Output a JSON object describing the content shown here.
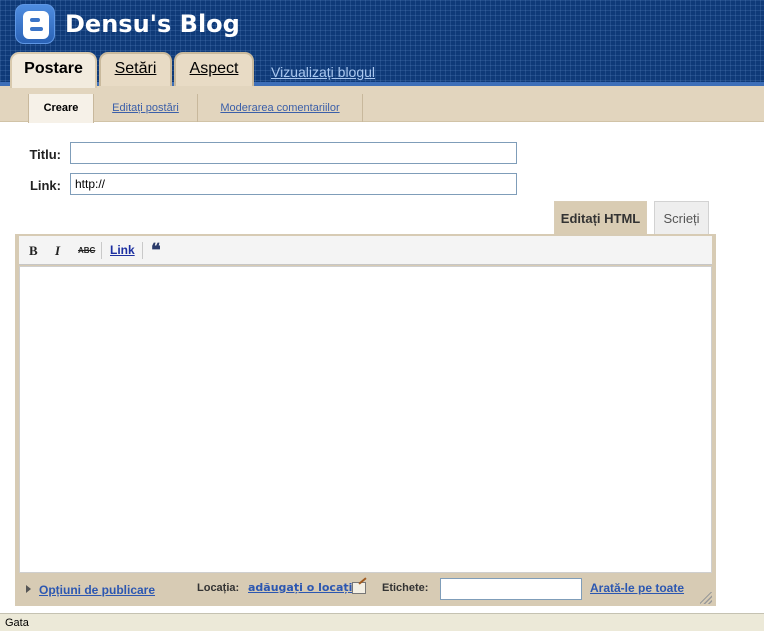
{
  "header": {
    "blog_title": "Densu's Blog",
    "logo_icon": "blogger-logo-icon",
    "tabs": [
      {
        "label": "Postare",
        "active": true
      },
      {
        "label": "Setări",
        "active": false
      },
      {
        "label": "Aspect",
        "active": false
      }
    ],
    "view_blog_link": "Vizualizați blogul"
  },
  "subnav": {
    "items": [
      {
        "label": "Creare",
        "active": true
      },
      {
        "label": "Editați postări",
        "active": false
      },
      {
        "label": "Moderarea comentariilor",
        "active": false
      }
    ]
  },
  "form": {
    "title_label": "Titlu:",
    "title_value": "",
    "link_label": "Link:",
    "link_value": "http://"
  },
  "editor": {
    "mode_tabs": [
      {
        "label": "Editați HTML",
        "active": true
      },
      {
        "label": "Scrieți",
        "active": false
      }
    ],
    "toolbar": {
      "bold": "B",
      "italic": "I",
      "strike": "ABC",
      "link": "Link",
      "quote": "❝"
    },
    "body": ""
  },
  "footer": {
    "publish_options": "Opțiuni de publicare",
    "location_label": "Locația:",
    "location_link": "adăugați o locație",
    "labels_label": "Etichete:",
    "labels_value": "",
    "show_all": "Arată-le pe toate"
  },
  "status_bar": {
    "text": "Gata"
  },
  "colors": {
    "header_bg": "#0f3a78",
    "tab_bg": "#e8dbc5",
    "subnav_bg": "#e2d5be",
    "link": "#2c57b1"
  }
}
